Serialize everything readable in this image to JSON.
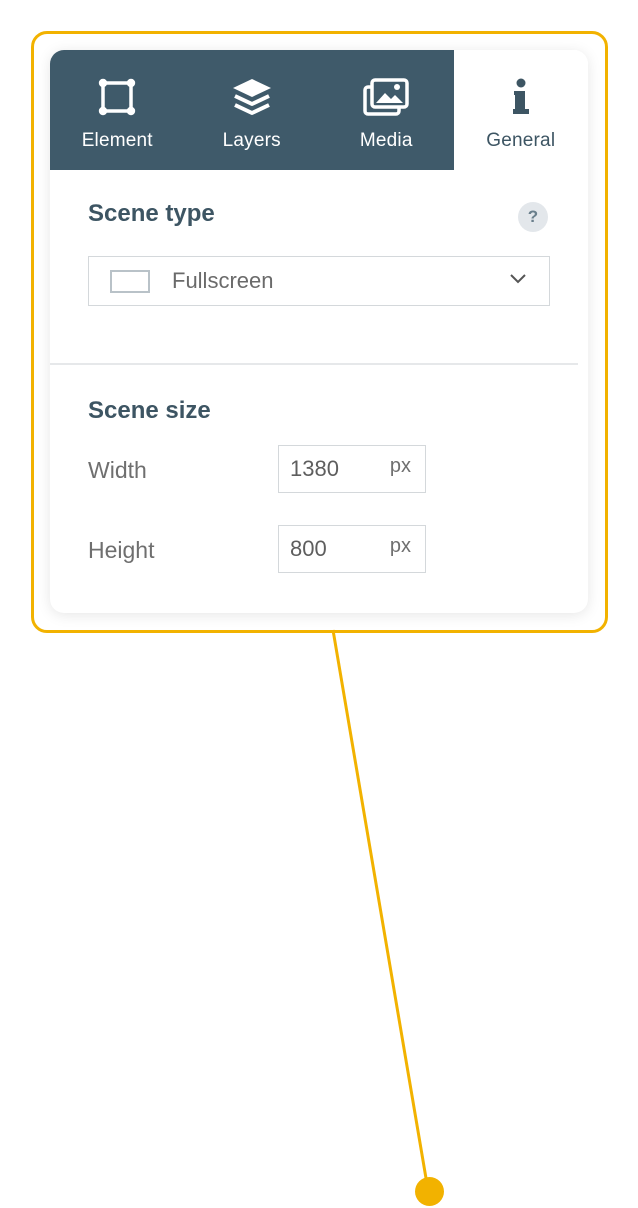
{
  "tabs": [
    {
      "label": "Element",
      "icon": "element-frame-icon",
      "active": false
    },
    {
      "label": "Layers",
      "icon": "layers-icon",
      "active": false
    },
    {
      "label": "Media",
      "icon": "media-icon",
      "active": false
    },
    {
      "label": "General",
      "icon": "info-icon",
      "active": true
    }
  ],
  "scene_type": {
    "title": "Scene type",
    "help_icon": "help-icon",
    "help_glyph": "?",
    "selected": "Fullscreen"
  },
  "scene_size": {
    "title": "Scene size",
    "width": {
      "label": "Width",
      "value": "1380",
      "unit": "px"
    },
    "height": {
      "label": "Height",
      "value": "800",
      "unit": "px"
    }
  },
  "colors": {
    "accent": "#f2b200",
    "tab_bg": "#3f5a6a",
    "heading": "#3d5563"
  }
}
